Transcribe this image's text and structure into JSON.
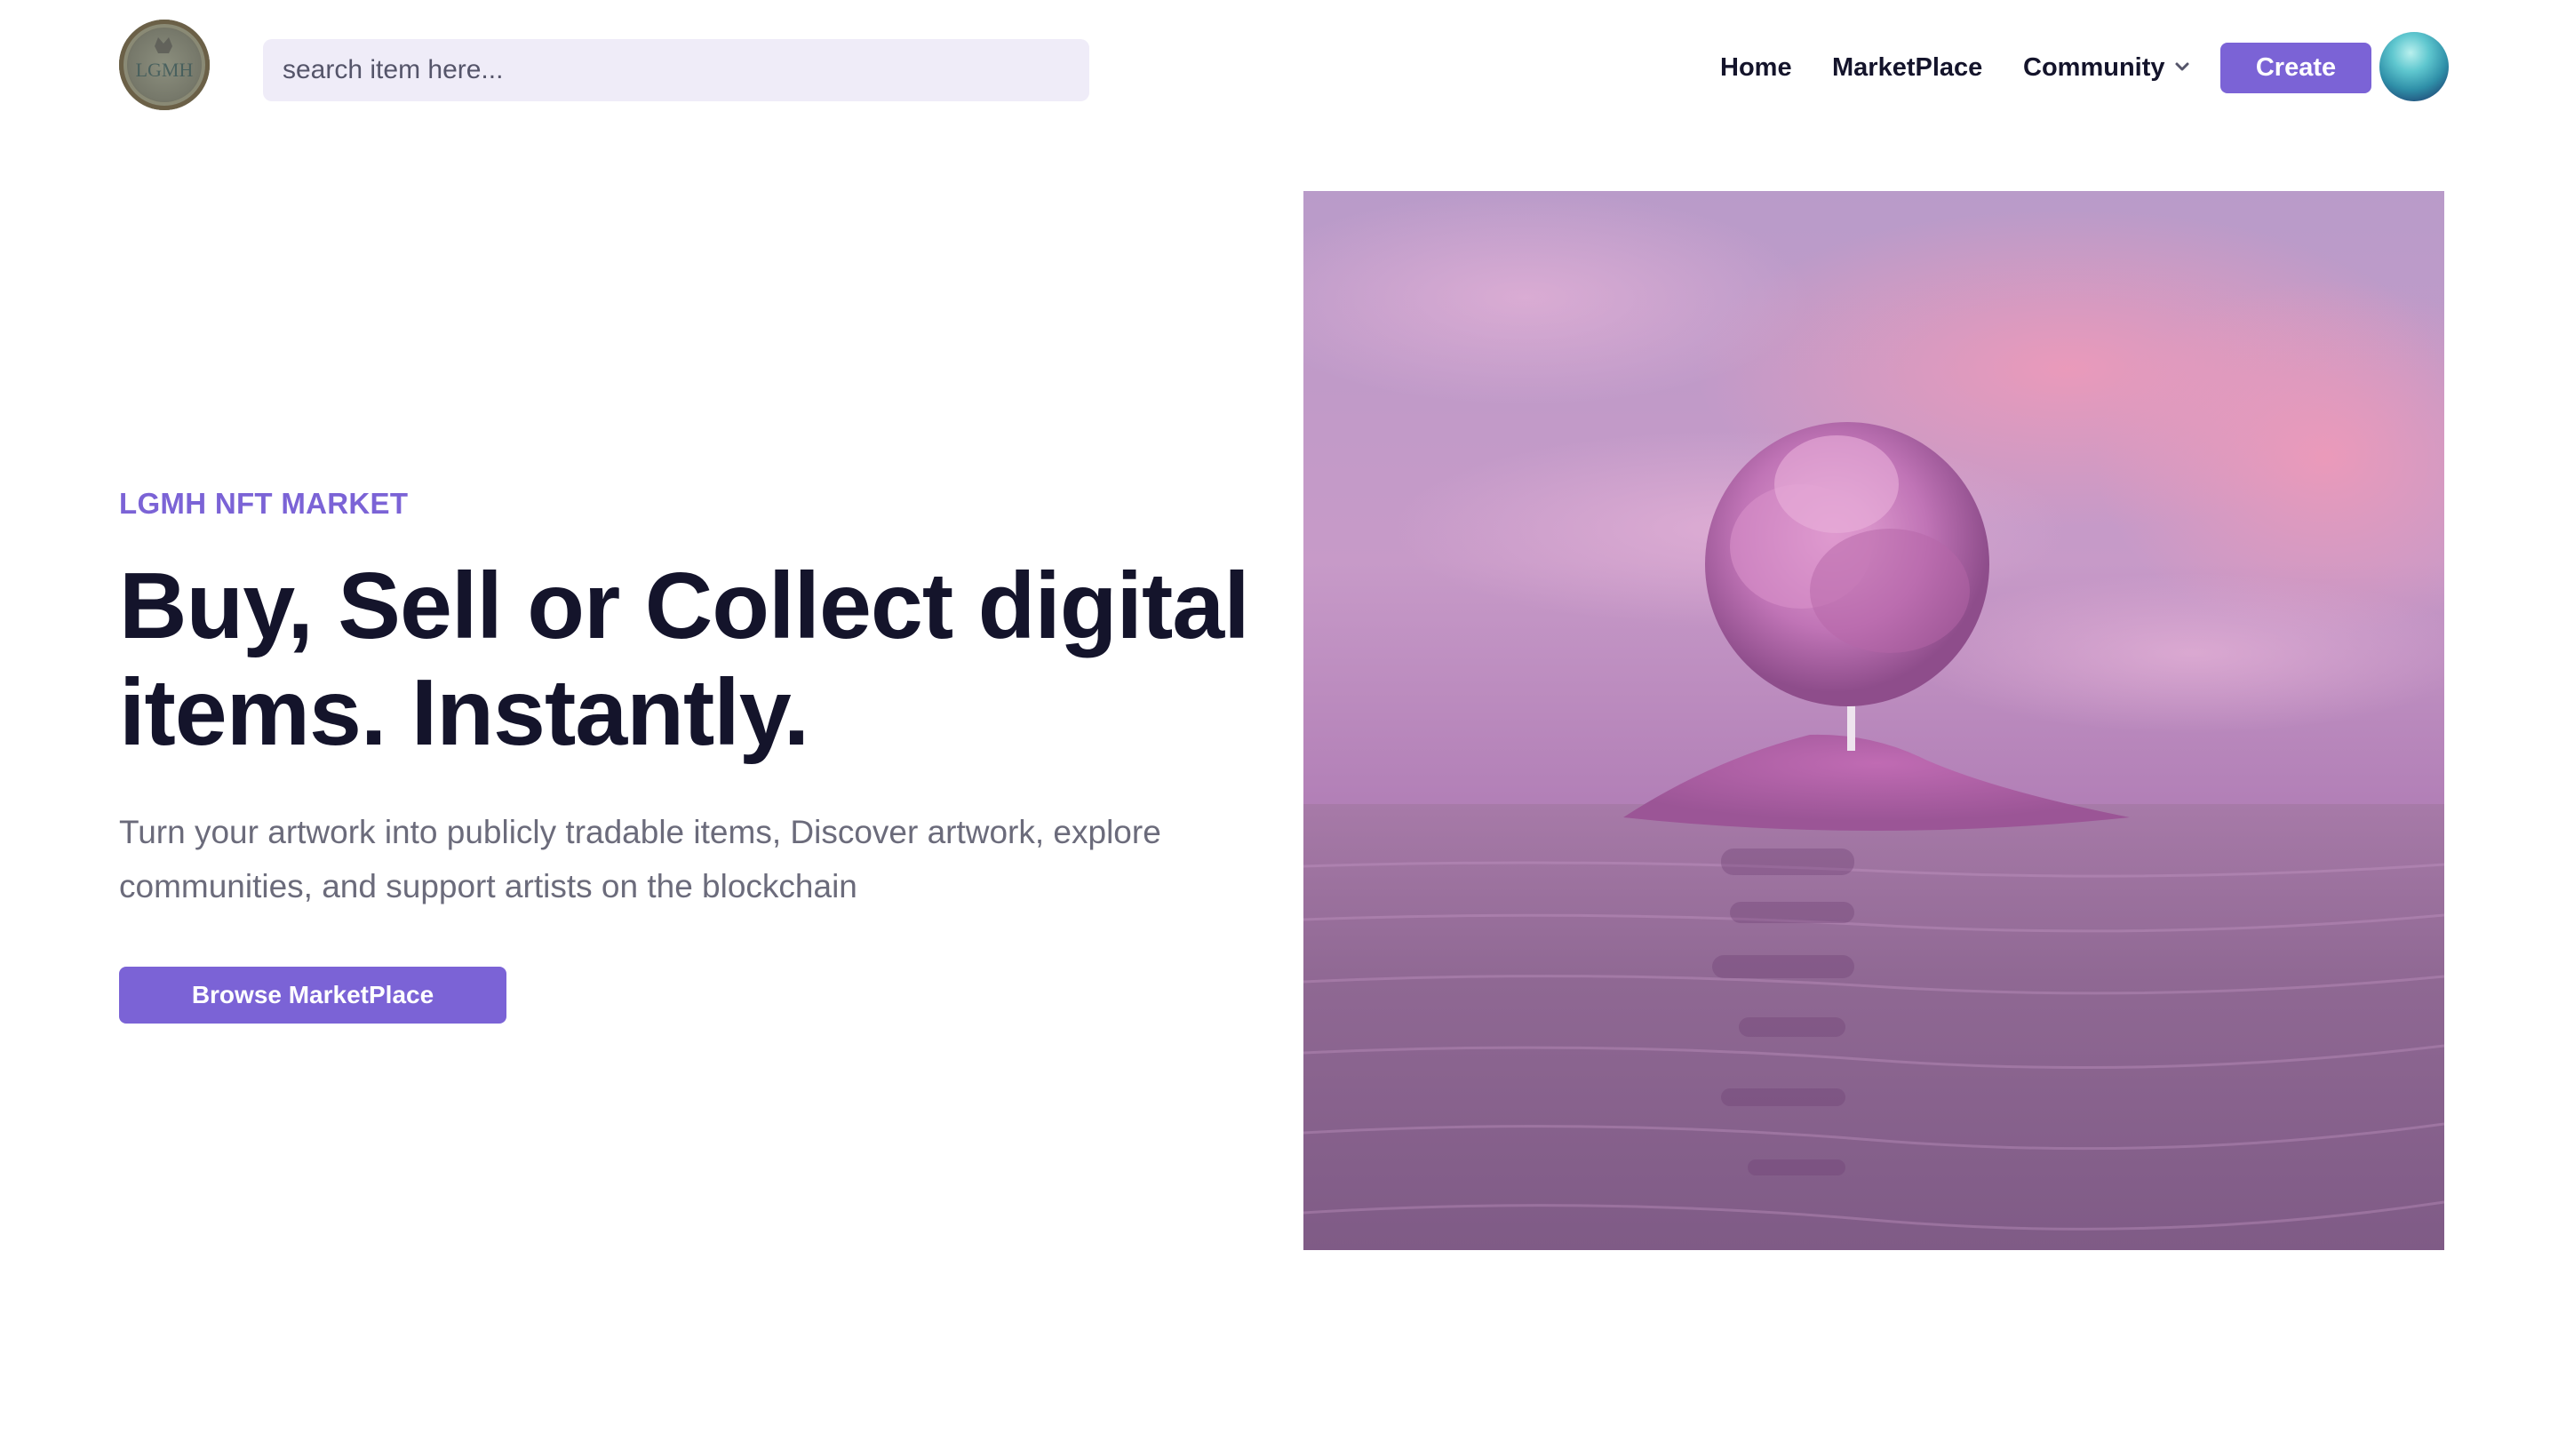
{
  "header": {
    "logo_text": "LGMH",
    "search": {
      "placeholder": "search item here..."
    },
    "nav": {
      "home": "Home",
      "marketplace": "MarketPlace",
      "community": "Community"
    },
    "create_label": "Create"
  },
  "hero": {
    "eyebrow": "LGMH NFT MARKET",
    "headline_line1": "Buy, Sell or Collect digital",
    "headline_line2": "items. Instantly.",
    "subtext_line1": "Turn your artwork into publicly tradable items, Discover artwork, explore",
    "subtext_line2": "communities, and support artists on the blockchain",
    "browse_label": "Browse MarketPlace"
  },
  "colors": {
    "accent": "#7b63d6",
    "heading": "#14142b",
    "body_text": "#6b6b7b",
    "search_bg": "#efecf8"
  },
  "icons": {
    "logo": "lgmh-logo-icon",
    "community_dropdown": "chevron-down-icon",
    "avatar": "user-avatar-icon"
  }
}
